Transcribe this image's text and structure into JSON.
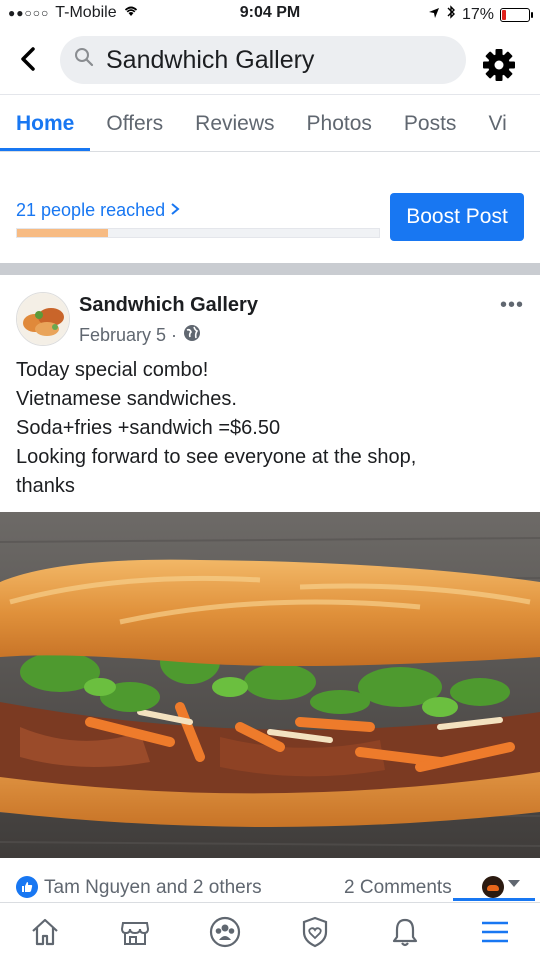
{
  "status_bar": {
    "carrier": "T-Mobile",
    "time": "9:04 PM",
    "battery": "17%",
    "battery_level": 0.17
  },
  "search": {
    "query": "Sandwhich Gallery"
  },
  "tabs": [
    {
      "label": "Home",
      "active": true
    },
    {
      "label": "Offers",
      "active": false
    },
    {
      "label": "Reviews",
      "active": false
    },
    {
      "label": "Photos",
      "active": false
    },
    {
      "label": "Posts",
      "active": false
    },
    {
      "label": "Vi",
      "active": false
    }
  ],
  "reach": {
    "label": "21 people reached",
    "progress": 0.25,
    "boost_label": "Boost Post"
  },
  "post": {
    "page_name": "Sandwhich Gallery",
    "date": "February 5 ·",
    "body_lines": [
      "Today special combo!",
      "Vietnamese sandwiches.",
      "Soda+fries +sandwich =$6.50",
      "Looking forward to see everyone at the shop,",
      "thanks"
    ]
  },
  "reactions": {
    "names": "Tam Nguyen and 2 others",
    "comments": "2 Comments"
  },
  "colors": {
    "accent": "#1877f2",
    "progress": "#f7bb83",
    "battery": "#e0231d"
  },
  "icons": [
    "back-chevron-icon",
    "search-icon",
    "gear-icon",
    "globe-icon",
    "more-icon",
    "like-icon",
    "home-icon",
    "marketplace-icon",
    "groups-icon",
    "shield-icon",
    "bell-icon",
    "menu-icon"
  ]
}
